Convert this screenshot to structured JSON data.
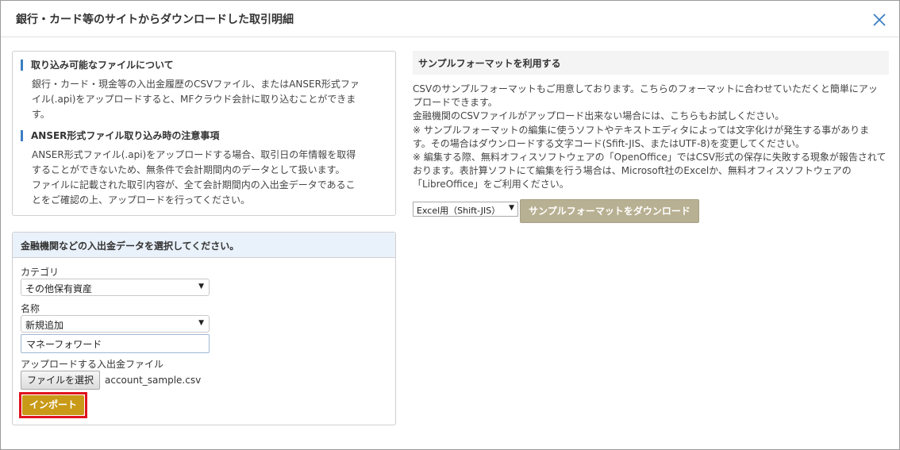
{
  "dialog": {
    "title": "銀行・カード等のサイトからダウンロードした取引明細"
  },
  "info": {
    "section1_title": "取り込み可能なファイルについて",
    "section1_lines": [
      "銀行・カード・現金等の入出金履歴のCSVファイル、またはANSER形式ファ",
      "イル(.api)をアップロードすると、MFクラウド会計に取り込むことができま",
      "す。"
    ],
    "section2_title": "ANSER形式ファイル取り込み時の注意事項",
    "section2_lines": [
      "ANSER形式ファイル(.api)をアップロードする場合、取引日の年情報を取得",
      "することができないため、無条件で会計期間内のデータとして扱います。",
      "ファイルに記載された取引内容が、全て会計期間内の入出金データであるこ",
      "とをご確認の上、アップロードを行ってください。"
    ]
  },
  "select_panel": {
    "header": "金融機関などの入出金データを選択してください。",
    "category_label": "カテゴリ",
    "category_value": "その他保有資産",
    "name_label": "名称",
    "name_value": "新規追加",
    "name_input_value": "マネーフォワード",
    "file_label": "アップロードする入出金ファイル",
    "file_button": "ファイルを選択",
    "file_name": "account_sample.csv",
    "import_button": "インポート"
  },
  "sample": {
    "title": "サンプルフォーマットを利用する",
    "lines": [
      "CSVのサンプルフォーマットもご用意しております。こちらのフォーマットに合わせていただくと簡単にアッ",
      "プロードできます。",
      "金融機関のCSVファイルがアップロード出来ない場合には、こちらもお試しください。",
      "※ サンプルフォーマットの編集に使うソフトやテキストエディタによっては文字化けが発生する事がありま",
      "す。その場合はダウンロードする文字コード(Sfift-JIS、またはUTF-8)を変更してください。",
      "※ 編集する際、無料オフィスソフトウェアの「OpenOffice」ではCSV形式の保存に失敗する現象が報告されて",
      "おります。表計算ソフトにて編集を行う場合は、Microsoft社のExcelか、無料オフィスソフトウェアの",
      "「LibreOffice」をご利用ください。"
    ],
    "format_value": "Excel用（Shift-JIS）",
    "download_button": "サンプルフォーマットをダウンロード"
  },
  "colors": {
    "accent_blue": "#3b7ec2",
    "import_button": "#c99a17",
    "download_button": "#b8b092",
    "highlight_border": "#e0141e"
  },
  "icons": {
    "close": "close-icon",
    "dropdown": "chevron-down-icon"
  }
}
